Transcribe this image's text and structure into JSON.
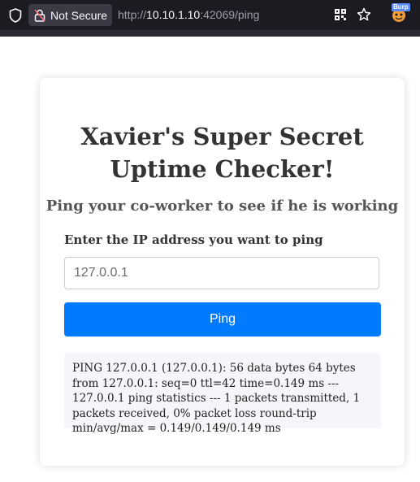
{
  "browser": {
    "security_label": "Not Secure",
    "url_scheme": "http://",
    "url_host": "10.10.1.10",
    "url_rest": ":42069/ping",
    "extension_badge": "Burp"
  },
  "page": {
    "title_line1": "Xavier's Super Secret",
    "title_line2": "Uptime Checker!",
    "subtitle": "Ping your co-worker to see if he is working",
    "ip_label": "Enter the IP address you want to ping",
    "ip_placeholder": "127.0.0.1",
    "button_label": "Ping",
    "output": "PING 127.0.0.1 (127.0.0.1): 56 data bytes 64 bytes from 127.0.0.1: seq=0 ttl=42 time=0.149 ms --- 127.0.0.1 ping statistics --- 1 packets transmitted, 1 packets received, 0% packet loss round-trip min/avg/max = 0.149/0.149/0.149 ms"
  },
  "colors": {
    "primary_button": "#007bff",
    "browser_toolbar": "#1c1b22"
  }
}
